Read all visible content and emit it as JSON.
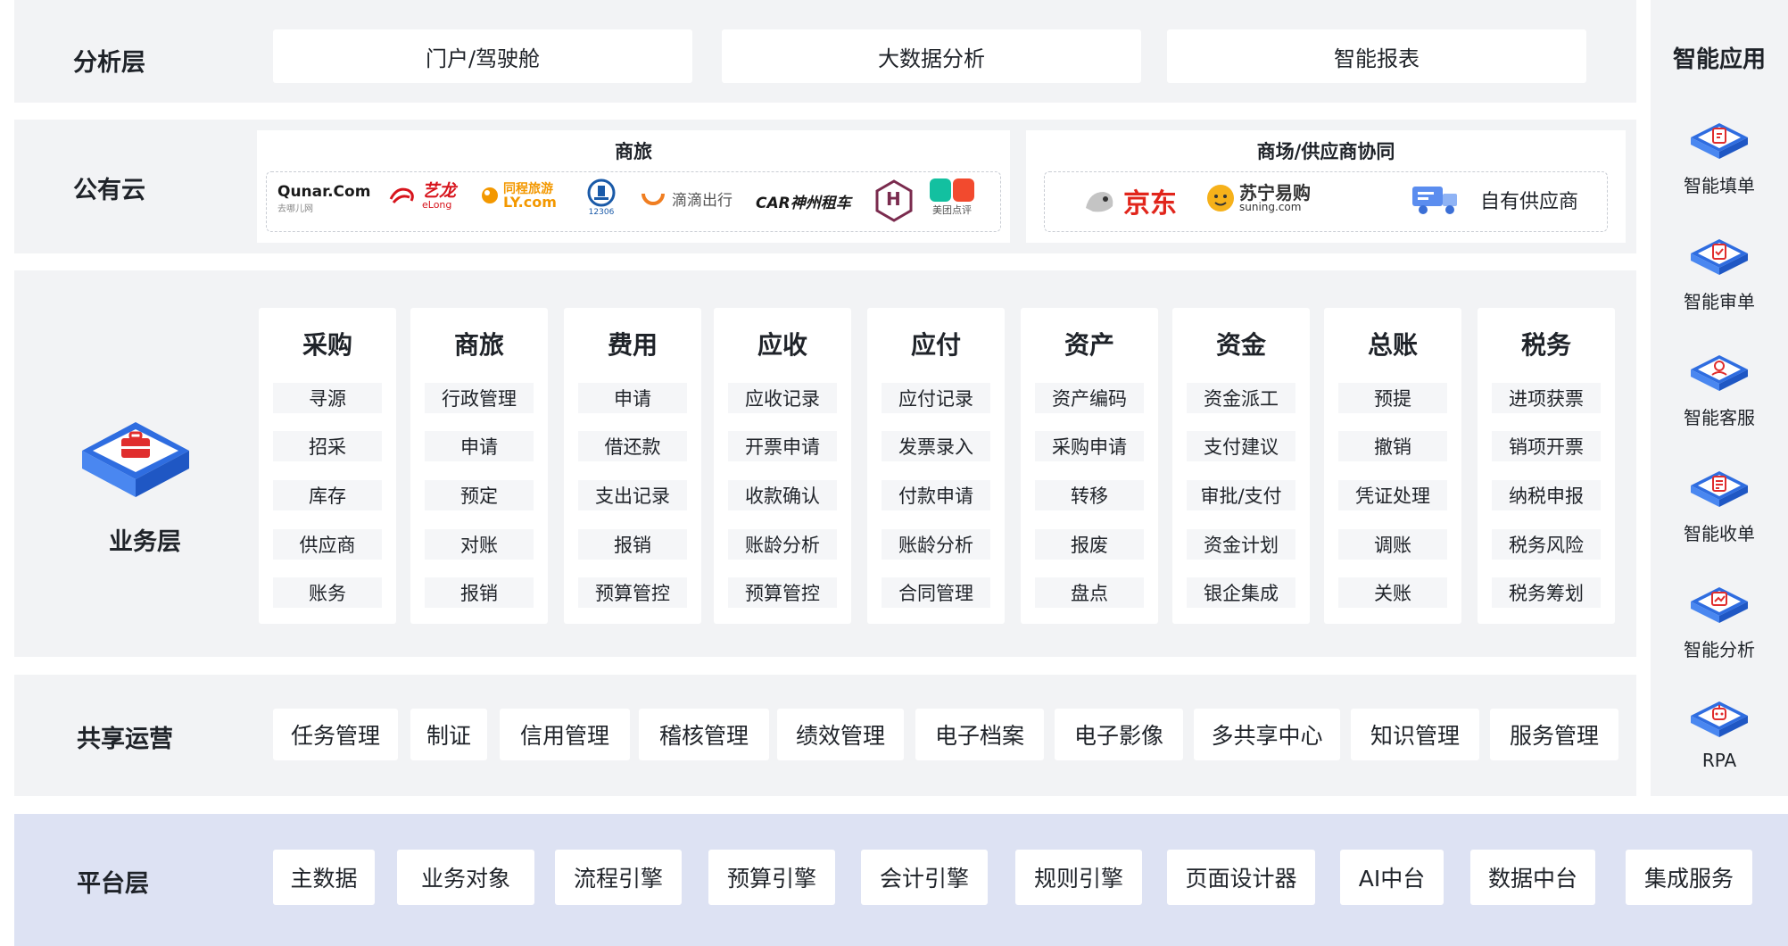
{
  "analysis": {
    "label": "分析层",
    "boxes": [
      "门户/驾驶舱",
      "大数据分析",
      "智能报表"
    ]
  },
  "public_cloud": {
    "label": "公有云",
    "travel": {
      "title": "商旅",
      "logos": [
        {
          "text": "Qunar.Com",
          "sub": "去哪儿网",
          "color": "#1a1a1a"
        },
        {
          "text": "艺龙",
          "sub": "eLong",
          "color": "#d7141c"
        },
        {
          "text": "同程旅游",
          "sub": "LY.com",
          "color": "#f39800"
        },
        {
          "text": "12306",
          "sub": "",
          "color": "#1a5aa8"
        },
        {
          "text": "滴滴出行",
          "sub": "",
          "color": "#f07e21"
        },
        {
          "text": "CAR神州租车",
          "sub": "",
          "color": "#1a1a1a"
        },
        {
          "text": "H",
          "sub": "",
          "color": "#7a2b4e"
        },
        {
          "text": "美团点评",
          "sub": "",
          "color": "#13c0a0"
        }
      ]
    },
    "mall": {
      "title": "商场/供应商协同",
      "logos": [
        {
          "text": "京东",
          "sub": "",
          "color": "#e1251b"
        },
        {
          "text": "苏宁易购",
          "sub": "suning.com",
          "color": "#333333"
        },
        {
          "text": "自有供应商",
          "sub": "",
          "color": "#1f2329"
        }
      ]
    }
  },
  "business": {
    "label": "业务层",
    "columns": [
      {
        "title": "采购",
        "items": [
          "寻源",
          "招采",
          "库存",
          "供应商",
          "账务"
        ]
      },
      {
        "title": "商旅",
        "items": [
          "行政管理",
          "申请",
          "预定",
          "对账",
          "报销"
        ]
      },
      {
        "title": "费用",
        "items": [
          "申请",
          "借还款",
          "支出记录",
          "报销",
          "预算管控"
        ]
      },
      {
        "title": "应收",
        "items": [
          "应收记录",
          "开票申请",
          "收款确认",
          "账龄分析",
          "预算管控"
        ]
      },
      {
        "title": "应付",
        "items": [
          "应付记录",
          "发票录入",
          "付款申请",
          "账龄分析",
          "合同管理"
        ]
      },
      {
        "title": "资产",
        "items": [
          "资产编码",
          "采购申请",
          "转移",
          "报废",
          "盘点"
        ]
      },
      {
        "title": "资金",
        "items": [
          "资金派工",
          "支付建议",
          "审批/支付",
          "资金计划",
          "银企集成"
        ]
      },
      {
        "title": "总账",
        "items": [
          "预提",
          "撤销",
          "凭证处理",
          "调账",
          "关账"
        ]
      },
      {
        "title": "税务",
        "items": [
          "进项获票",
          "销项开票",
          "纳税申报",
          "税务风险",
          "税务筹划"
        ]
      }
    ]
  },
  "shared_ops": {
    "label": "共享运营",
    "items": [
      "任务管理",
      "制证",
      "信用管理",
      "稽核管理",
      "绩效管理",
      "电子档案",
      "电子影像",
      "多共享中心",
      "知识管理",
      "服务管理"
    ]
  },
  "platform": {
    "label": "平台层",
    "items": [
      "主数据",
      "业务对象",
      "流程引擎",
      "预算引擎",
      "会计引擎",
      "规则引擎",
      "页面设计器",
      "AI中台",
      "数据中台",
      "集成服务"
    ]
  },
  "smart_apps": {
    "title": "智能应用",
    "items": [
      {
        "label": "智能填单",
        "icon": "form-fill-icon"
      },
      {
        "label": "智能审单",
        "icon": "review-icon"
      },
      {
        "label": "智能客服",
        "icon": "customer-service-icon"
      },
      {
        "label": "智能收单",
        "icon": "receipt-icon"
      },
      {
        "label": "智能分析",
        "icon": "analysis-icon"
      },
      {
        "label": "RPA",
        "icon": "robot-icon"
      }
    ]
  },
  "colors": {
    "band": "#f2f3f5",
    "platform": "#dde2f3",
    "accent": "#3b6fd6",
    "red": "#e02e2e"
  }
}
